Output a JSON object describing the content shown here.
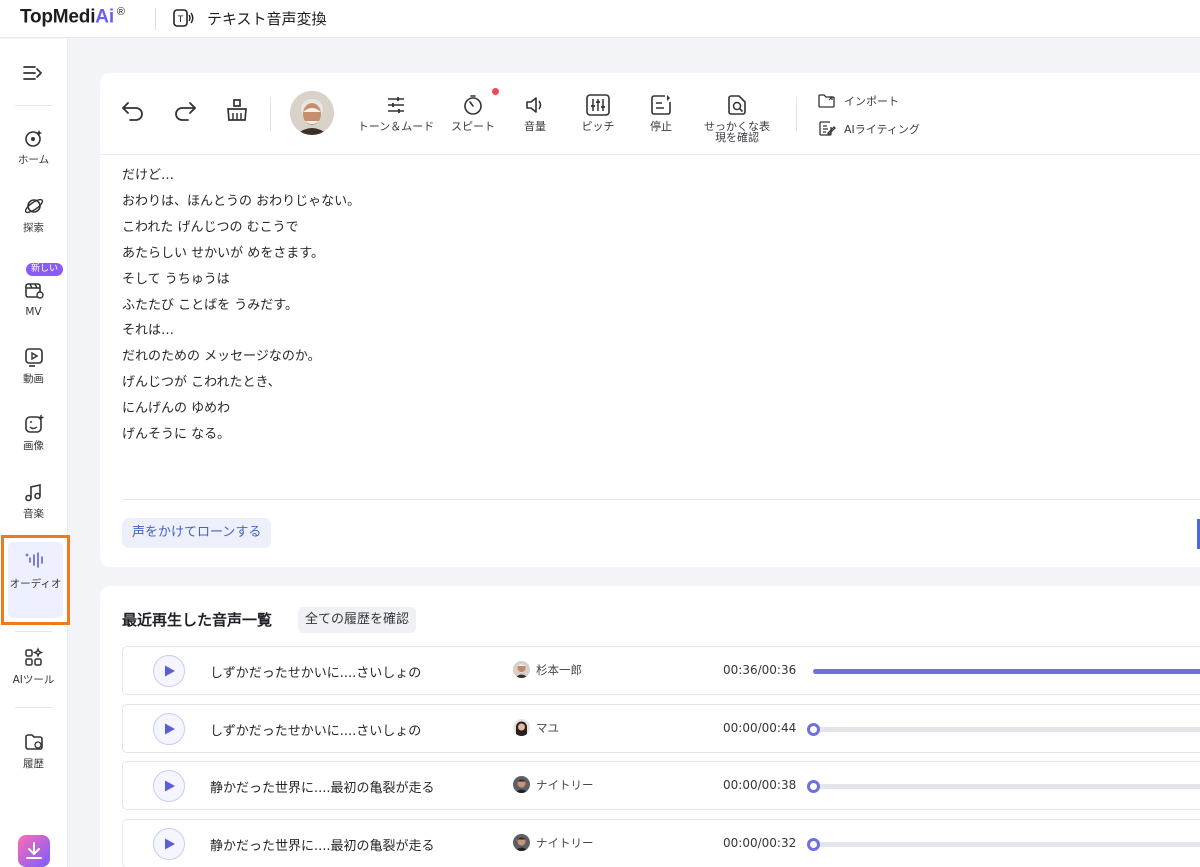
{
  "app": {
    "logo_text": "TopMedi",
    "logo_ai": "Ai",
    "logo_reg": "®",
    "tool_title": "テキスト音声変換"
  },
  "sidebar": {
    "badge_new": "新しい",
    "items": [
      {
        "label": "ホーム",
        "icon": "home-icon"
      },
      {
        "label": "探索",
        "icon": "explore-icon"
      },
      {
        "label": "MV",
        "icon": "mv-icon"
      },
      {
        "label": "動画",
        "icon": "video-icon"
      },
      {
        "label": "画像",
        "icon": "image-icon"
      },
      {
        "label": "音楽",
        "icon": "music-icon"
      },
      {
        "label": "オーディオ",
        "icon": "audio-icon"
      },
      {
        "label": "AIツール",
        "icon": "ai-tools-icon"
      },
      {
        "label": "履歴",
        "icon": "history-icon"
      }
    ]
  },
  "toolbar": {
    "tools": [
      {
        "label": "トーン＆ムード",
        "icon": "sliders-icon"
      },
      {
        "label": "スピート",
        "icon": "timer-icon"
      },
      {
        "label": "音量",
        "icon": "speaker-icon"
      },
      {
        "label": "ピッチ",
        "icon": "equalizer-icon"
      },
      {
        "label": "停止",
        "icon": "pause-text-icon"
      },
      {
        "label": "せっかくな表\n現を確認",
        "icon": "search-doc-icon"
      }
    ],
    "import_label": "インポート",
    "ai_writing_label": "AIライティング"
  },
  "editor": {
    "lines": [
      "だけど…",
      "おわりは、ほんとうの おわりじゃない。",
      "こわれた げんじつの むこうで",
      "あたらしい せかいが めをさます。",
      "そして うちゅうは",
      "ふたたび ことばを うみだす。",
      "それは…",
      "だれのための メッセージなのか。",
      "げんじつが こわれたとき、",
      "にんげんの ゆめわ",
      "げんそうに なる。"
    ],
    "clone_button": "声をかけてローンする"
  },
  "recent": {
    "title": "最近再生した音声一覧",
    "history_button": "全ての履歴を確認",
    "rows": [
      {
        "title": "しずかだったせかいに....さいしょの",
        "voice": "杉本一郎",
        "time": "00:36/00:36",
        "progress": 1.0
      },
      {
        "title": "しずかだったせかいに....さいしょの",
        "voice": "マユ",
        "time": "00:00/00:44",
        "progress": 0.0
      },
      {
        "title": "静かだった世界に....最初の亀裂が走る",
        "voice": "ナイトリー",
        "time": "00:00/00:38",
        "progress": 0.0
      },
      {
        "title": "静かだった世界に....最初の亀裂が走る",
        "voice": "ナイトリー",
        "time": "00:00/00:32",
        "progress": 0.0
      }
    ]
  },
  "colors": {
    "accent": "#6f6fe4",
    "highlight_border": "#f07a1f",
    "badge": "#8a5cf6"
  }
}
